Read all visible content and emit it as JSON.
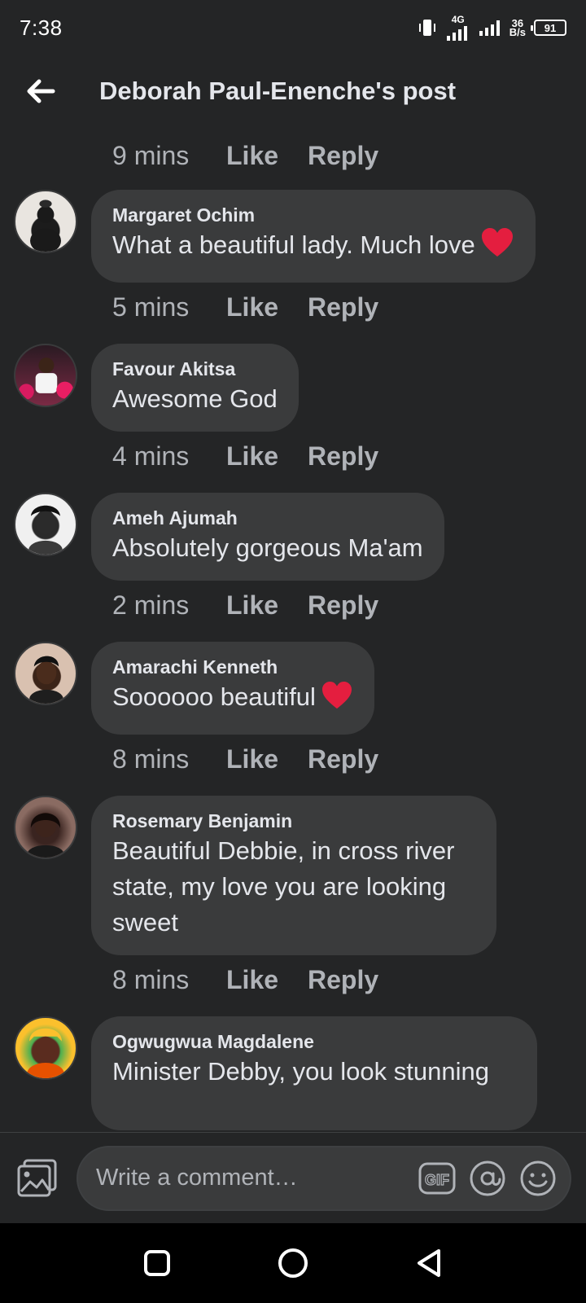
{
  "status_bar": {
    "time": "7:38",
    "network_type": "4G",
    "data_speed_value": "36",
    "data_speed_unit": "B/s",
    "battery": "91"
  },
  "header": {
    "back_icon": "arrow-left-icon",
    "title": "Deborah Paul-Enenche's post"
  },
  "top_meta": {
    "time": "9 mins",
    "like": "Like",
    "reply": "Reply"
  },
  "comments": [
    {
      "author": "Margaret Ochim",
      "text": "What a beautiful lady. Much love",
      "has_heart": true,
      "time": "5 mins",
      "like": "Like",
      "reply": "Reply"
    },
    {
      "author": "Favour Akitsa",
      "text": "Awesome God",
      "has_heart": false,
      "time": "4 mins",
      "like": "Like",
      "reply": "Reply"
    },
    {
      "author": "Ameh Ajumah",
      "text": "Absolutely gorgeous Ma'am",
      "has_heart": false,
      "time": "2 mins",
      "like": "Like",
      "reply": "Reply"
    },
    {
      "author": "Amarachi Kenneth",
      "text": "Soooooo beautiful",
      "has_heart": true,
      "time": "8 mins",
      "like": "Like",
      "reply": "Reply"
    },
    {
      "author": "Rosemary Benjamin",
      "text": "Beautiful Debbie, in cross river state, my love you are looking sweet",
      "has_heart": false,
      "time": "8 mins",
      "like": "Like",
      "reply": "Reply"
    },
    {
      "author": "Ogwugwua Magdalene",
      "text": "Minister Debby, you look stunning",
      "has_heart": false
    }
  ],
  "composer": {
    "placeholder": "Write a comment…",
    "photo_icon": "photo-icon",
    "gif_label": "GIF",
    "mention_icon": "at-icon",
    "emoji_icon": "emoji-icon"
  },
  "nav_bar": {
    "recents_icon": "square-icon",
    "home_icon": "circle-icon",
    "back_icon": "triangle-back-icon"
  },
  "colors": {
    "background": "#242526",
    "bubble": "#3a3b3c",
    "primary_text": "#e4e6eb",
    "secondary_text": "#b0b3b8",
    "heart": "#e41e3f"
  }
}
